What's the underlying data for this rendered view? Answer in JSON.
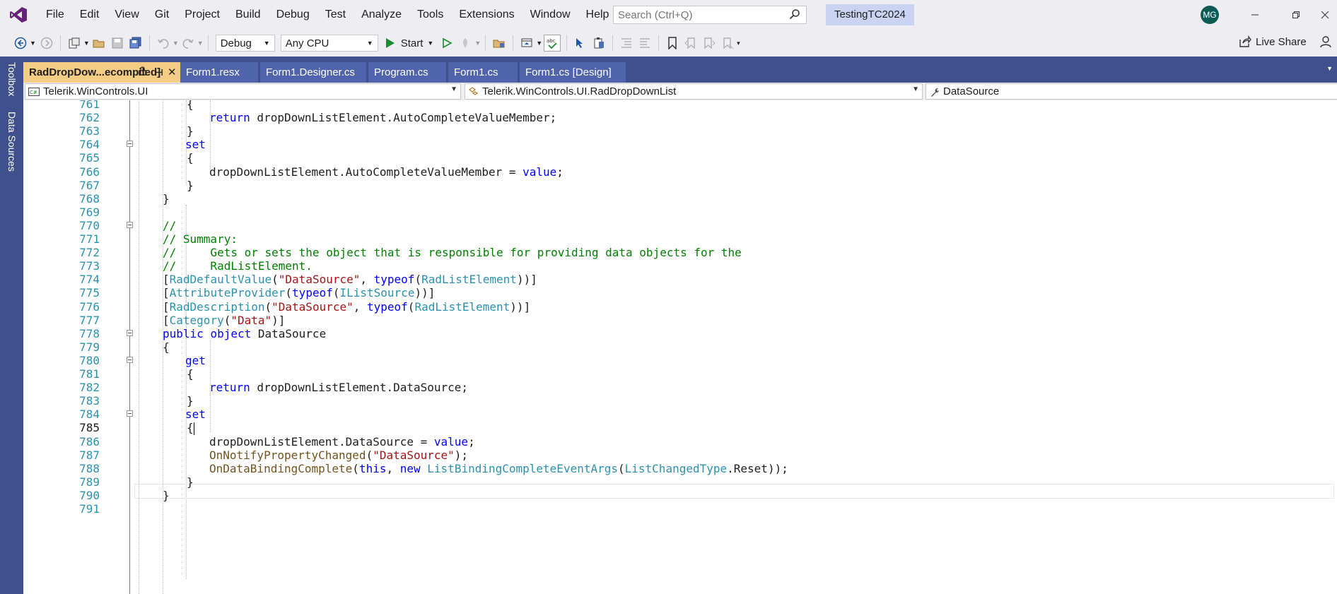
{
  "menubar": {
    "items": [
      "File",
      "Edit",
      "View",
      "Git",
      "Project",
      "Build",
      "Debug",
      "Test",
      "Analyze",
      "Tools",
      "Extensions",
      "Window",
      "Help"
    ],
    "search_placeholder": "Search (Ctrl+Q)",
    "solution_name": "TestingTC2024",
    "avatar_initials": "MG"
  },
  "toolbar": {
    "config": "Debug",
    "platform": "Any CPU",
    "start_label": "Start",
    "live_share_label": "Live Share"
  },
  "dock": {
    "toolbox_label": "Toolbox",
    "data_sources_label": "Data Sources"
  },
  "tabs": [
    {
      "label": "RadDropDow...ecompiled]",
      "active": true
    },
    {
      "label": "Form1.resx",
      "active": false
    },
    {
      "label": "Form1.Designer.cs",
      "active": false
    },
    {
      "label": "Program.cs",
      "active": false
    },
    {
      "label": "Form1.cs",
      "active": false
    },
    {
      "label": "Form1.cs [Design]",
      "active": false
    }
  ],
  "navbar": {
    "project": "Telerik.WinControls.UI",
    "type": "Telerik.WinControls.UI.RadDropDownList",
    "member": "DataSource"
  },
  "editor": {
    "current_line": 785,
    "lines": [
      {
        "n": "761",
        "tokens": [
          {
            "t": "{",
            "c": "pl"
          }
        ]
      },
      {
        "n": "762",
        "tokens": [
          {
            "t": "return",
            "c": "kw"
          },
          {
            "t": " dropDownListElement.AutoCompleteValueMember;",
            "c": "pl"
          }
        ]
      },
      {
        "n": "763",
        "tokens": [
          {
            "t": "}",
            "c": "pl"
          }
        ]
      },
      {
        "n": "764",
        "tokens": [
          {
            "t": "set",
            "c": "kw"
          }
        ]
      },
      {
        "n": "765",
        "tokens": [
          {
            "t": "{",
            "c": "pl"
          }
        ]
      },
      {
        "n": "766",
        "tokens": [
          {
            "t": "dropDownListElement.AutoCompleteValueMember = ",
            "c": "pl"
          },
          {
            "t": "value",
            "c": "kw"
          },
          {
            "t": ";",
            "c": "pl"
          }
        ]
      },
      {
        "n": "767",
        "tokens": [
          {
            "t": "}",
            "c": "pl"
          }
        ]
      },
      {
        "n": "768",
        "tokens": [
          {
            "t": "}",
            "c": "pl"
          }
        ]
      },
      {
        "n": "769",
        "tokens": []
      },
      {
        "n": "770",
        "tokens": [
          {
            "t": "//",
            "c": "cm"
          }
        ]
      },
      {
        "n": "771",
        "tokens": [
          {
            "t": "// Summary:",
            "c": "cm"
          }
        ]
      },
      {
        "n": "772",
        "tokens": [
          {
            "t": "//     Gets or sets the object that is responsible for providing data objects for the",
            "c": "cm"
          }
        ]
      },
      {
        "n": "773",
        "tokens": [
          {
            "t": "//     RadListElement.",
            "c": "cm"
          }
        ]
      },
      {
        "n": "774",
        "tokens": [
          {
            "t": "[",
            "c": "pl"
          },
          {
            "t": "RadDefaultValue",
            "c": "ty"
          },
          {
            "t": "(",
            "c": "pl"
          },
          {
            "t": "\"DataSource\"",
            "c": "st"
          },
          {
            "t": ", ",
            "c": "pl"
          },
          {
            "t": "typeof",
            "c": "kw"
          },
          {
            "t": "(",
            "c": "pl"
          },
          {
            "t": "RadListElement",
            "c": "ty"
          },
          {
            "t": "))]",
            "c": "pl"
          }
        ]
      },
      {
        "n": "775",
        "tokens": [
          {
            "t": "[",
            "c": "pl"
          },
          {
            "t": "AttributeProvider",
            "c": "ty"
          },
          {
            "t": "(",
            "c": "pl"
          },
          {
            "t": "typeof",
            "c": "kw"
          },
          {
            "t": "(",
            "c": "pl"
          },
          {
            "t": "IListSource",
            "c": "ty"
          },
          {
            "t": "))]",
            "c": "pl"
          }
        ]
      },
      {
        "n": "776",
        "tokens": [
          {
            "t": "[",
            "c": "pl"
          },
          {
            "t": "RadDescription",
            "c": "ty"
          },
          {
            "t": "(",
            "c": "pl"
          },
          {
            "t": "\"DataSource\"",
            "c": "st"
          },
          {
            "t": ", ",
            "c": "pl"
          },
          {
            "t": "typeof",
            "c": "kw"
          },
          {
            "t": "(",
            "c": "pl"
          },
          {
            "t": "RadListElement",
            "c": "ty"
          },
          {
            "t": "))]",
            "c": "pl"
          }
        ]
      },
      {
        "n": "777",
        "tokens": [
          {
            "t": "[",
            "c": "pl"
          },
          {
            "t": "Category",
            "c": "ty"
          },
          {
            "t": "(",
            "c": "pl"
          },
          {
            "t": "\"Data\"",
            "c": "st"
          },
          {
            "t": ")]",
            "c": "pl"
          }
        ]
      },
      {
        "n": "778",
        "tokens": [
          {
            "t": "public",
            "c": "kw"
          },
          {
            "t": " ",
            "c": "pl"
          },
          {
            "t": "object",
            "c": "kw"
          },
          {
            "t": " DataSource",
            "c": "pl"
          }
        ]
      },
      {
        "n": "779",
        "tokens": [
          {
            "t": "{",
            "c": "pl"
          }
        ]
      },
      {
        "n": "780",
        "tokens": [
          {
            "t": "get",
            "c": "kw"
          }
        ]
      },
      {
        "n": "781",
        "tokens": [
          {
            "t": "{",
            "c": "pl"
          }
        ]
      },
      {
        "n": "782",
        "tokens": [
          {
            "t": "return",
            "c": "kw"
          },
          {
            "t": " dropDownListElement.DataSource;",
            "c": "pl"
          }
        ]
      },
      {
        "n": "783",
        "tokens": [
          {
            "t": "}",
            "c": "pl"
          }
        ]
      },
      {
        "n": "784",
        "tokens": [
          {
            "t": "set",
            "c": "kw"
          }
        ]
      },
      {
        "n": "785",
        "tokens": [
          {
            "t": "{",
            "c": "pl"
          }
        ]
      },
      {
        "n": "786",
        "tokens": [
          {
            "t": "dropDownListElement.DataSource = ",
            "c": "pl"
          },
          {
            "t": "value",
            "c": "kw"
          },
          {
            "t": ";",
            "c": "pl"
          }
        ]
      },
      {
        "n": "787",
        "tokens": [
          {
            "t": "OnNotifyPropertyChanged",
            "c": "mt"
          },
          {
            "t": "(",
            "c": "pl"
          },
          {
            "t": "\"DataSource\"",
            "c": "st"
          },
          {
            "t": ");",
            "c": "pl"
          }
        ]
      },
      {
        "n": "788",
        "tokens": [
          {
            "t": "OnDataBindingComplete",
            "c": "mt"
          },
          {
            "t": "(",
            "c": "pl"
          },
          {
            "t": "this",
            "c": "kw"
          },
          {
            "t": ", ",
            "c": "pl"
          },
          {
            "t": "new",
            "c": "kw"
          },
          {
            "t": " ",
            "c": "pl"
          },
          {
            "t": "ListBindingCompleteEventArgs",
            "c": "ty"
          },
          {
            "t": "(",
            "c": "pl"
          },
          {
            "t": "ListChangedType",
            "c": "ty"
          },
          {
            "t": ".Reset));",
            "c": "pl"
          }
        ]
      },
      {
        "n": "789",
        "tokens": [
          {
            "t": "}",
            "c": "pl"
          }
        ]
      },
      {
        "n": "790",
        "tokens": [
          {
            "t": "}",
            "c": "pl"
          }
        ]
      },
      {
        "n": "791",
        "tokens": []
      }
    ]
  }
}
